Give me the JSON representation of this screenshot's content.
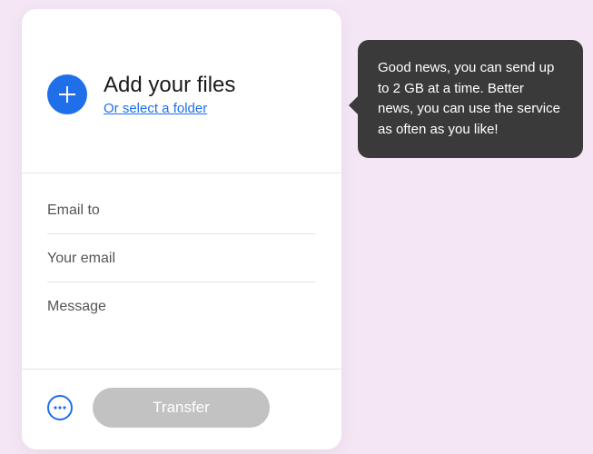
{
  "upload": {
    "title": "Add your files",
    "folder_link": "Or select a folder"
  },
  "fields": {
    "email_to_placeholder": "Email to",
    "your_email_placeholder": "Your email",
    "message_placeholder": "Message",
    "email_to_value": "",
    "your_email_value": "",
    "message_value": ""
  },
  "footer": {
    "transfer_label": "Transfer"
  },
  "tooltip": {
    "text": "Good news, you can send up to 2 GB at a time. Better news, you can use the service as often as you like!"
  },
  "colors": {
    "accent": "#1f6feb",
    "card_bg": "#ffffff",
    "page_bg": "#f5e6f5",
    "tooltip_bg": "#3a3a3a",
    "disabled_button": "#c2c2c2"
  }
}
